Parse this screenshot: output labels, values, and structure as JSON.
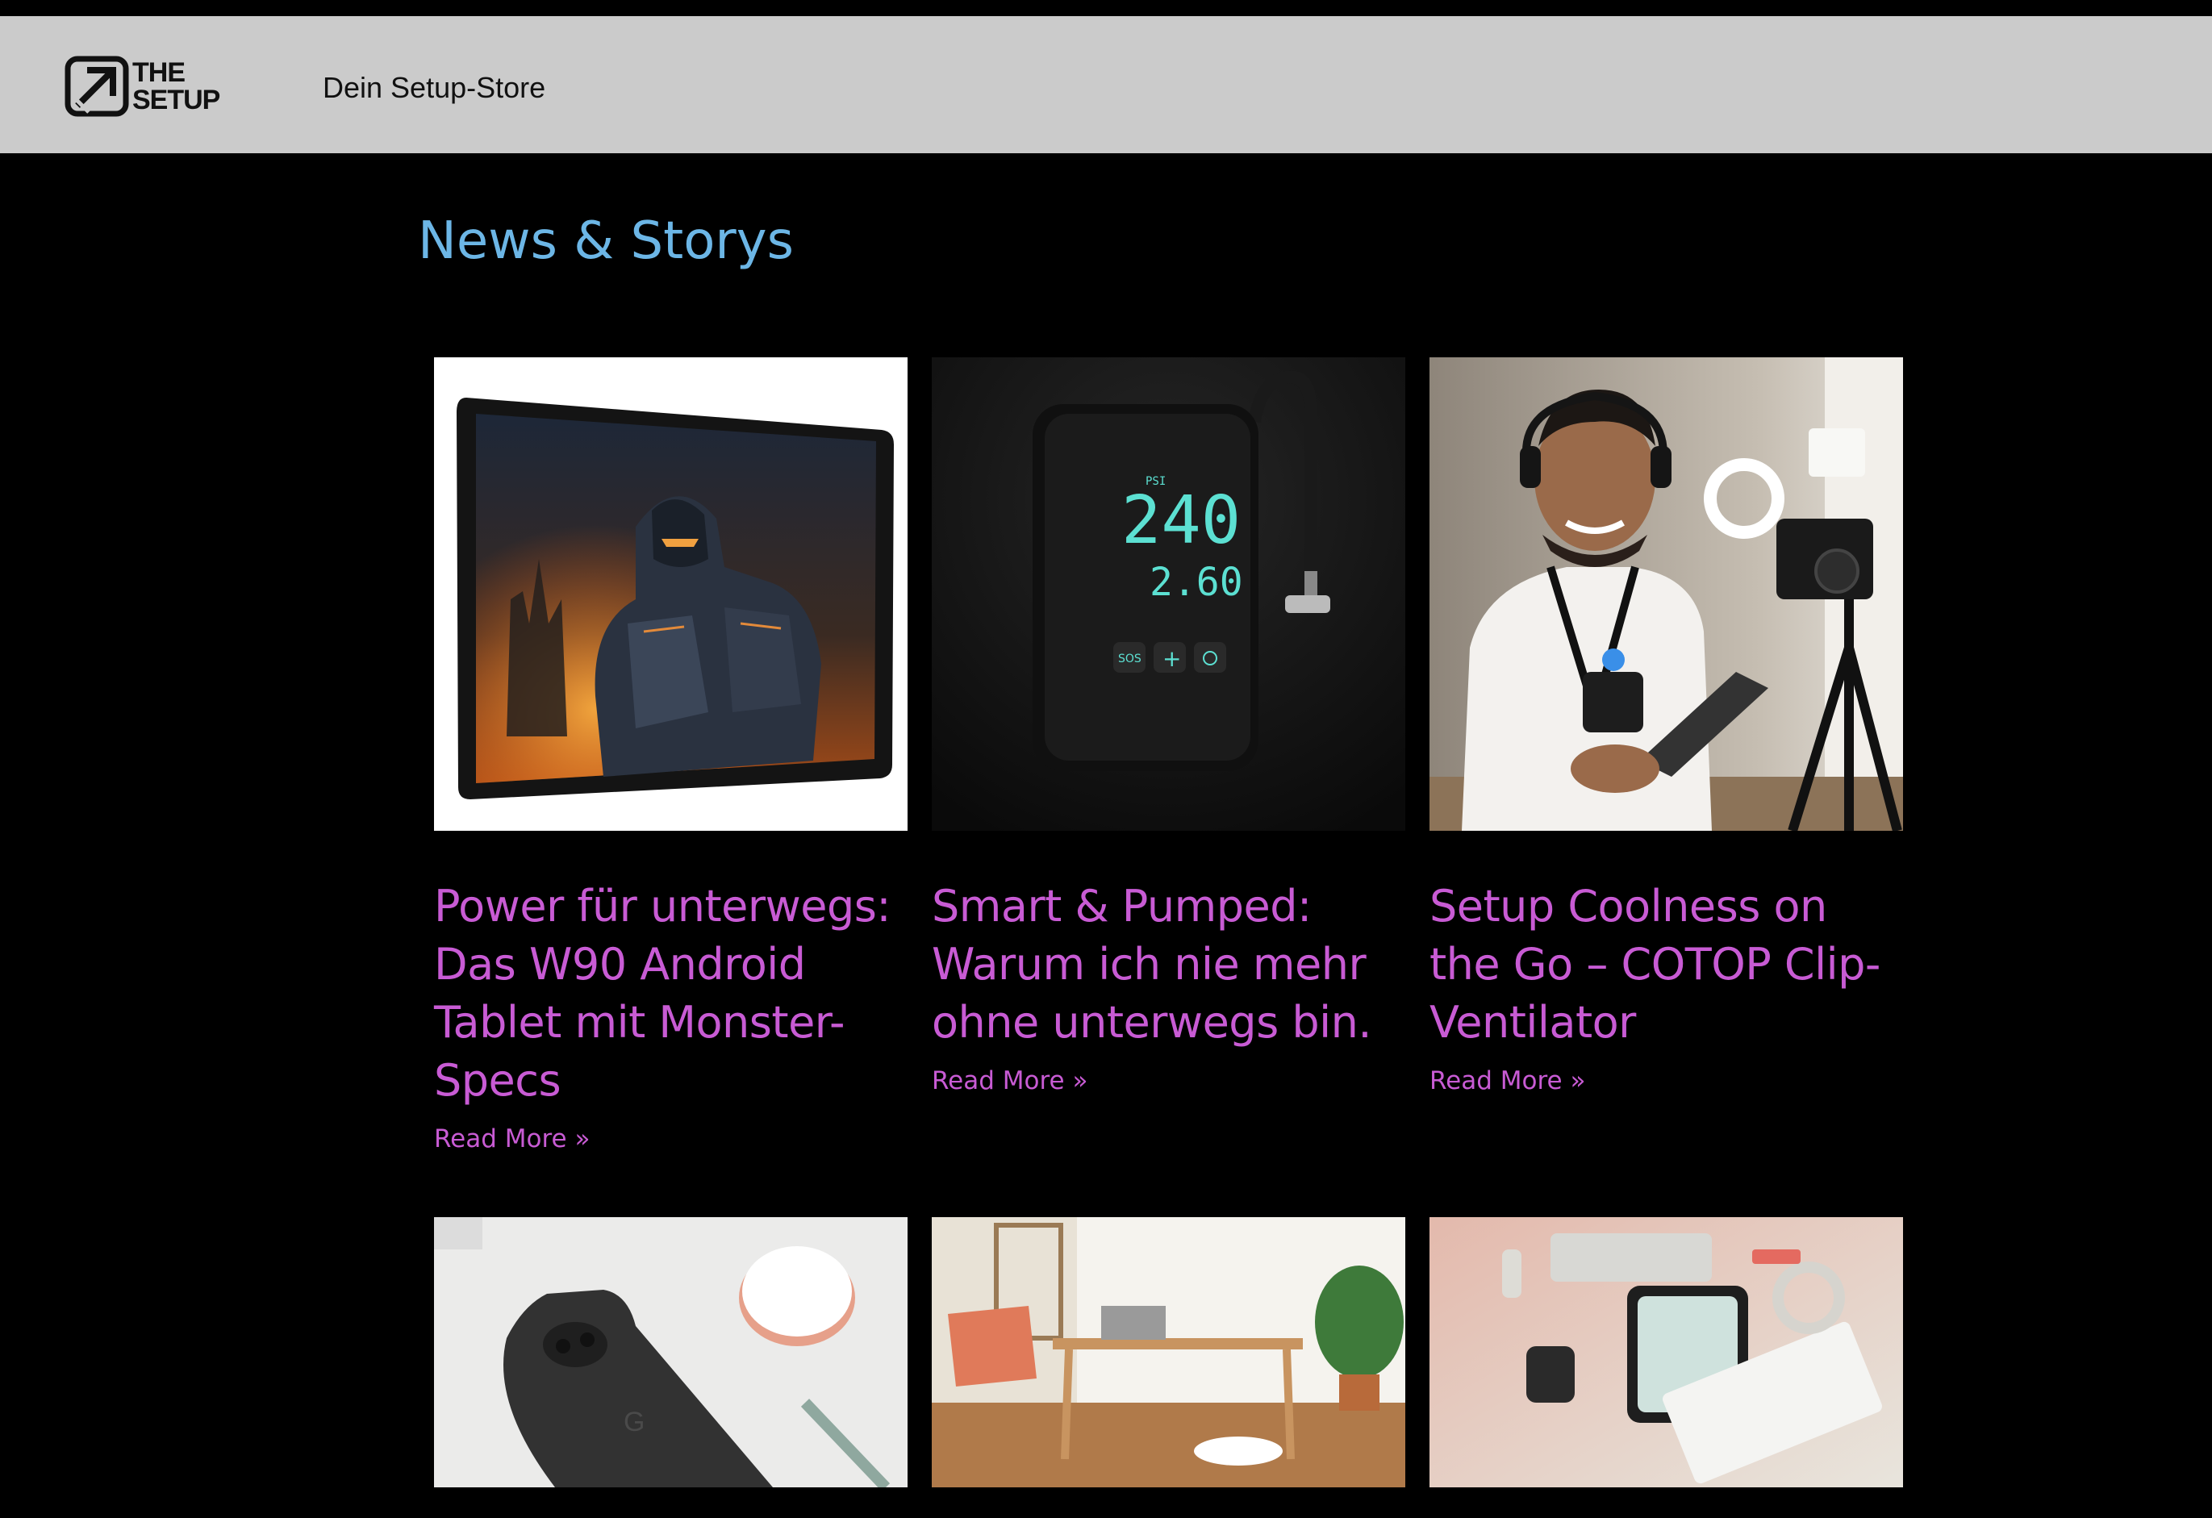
{
  "header": {
    "logo_line1": "THE",
    "logo_line2": "SETUP",
    "tagline": "Dein Setup-Store"
  },
  "section": {
    "title": "News & Storys"
  },
  "posts": [
    {
      "title": "Power für unterwegs: Das W90 Android Tablet mit Monster-Specs",
      "read_more": "Read More »",
      "image": "tablet-with-armored-robot-wallpaper"
    },
    {
      "title": "Smart & Pumped: Warum ich nie mehr ohne unterwegs bin.",
      "read_more": "Read More »",
      "image": "digital-air-pump-display",
      "display_top": "240",
      "display_bottom": "2.60",
      "display_label": "PSI",
      "button_sos": "SOS"
    },
    {
      "title": "Setup Coolness on the Go – COTOP Clip-Ventilator",
      "read_more": "Read More »",
      "image": "man-with-headphones-ring-light-camera"
    },
    {
      "image": "black-smartphone-with-wireless-charger"
    },
    {
      "image": "home-office-desk-with-robot-vacuum"
    },
    {
      "image": "flatlay-gadgets-smartwatch-tablet-keyboard"
    }
  ],
  "colors": {
    "header_bg": "#cbcbcb",
    "page_bg": "#000000",
    "section_title": "#6cb6e6",
    "post_title": "#c85bd4"
  }
}
